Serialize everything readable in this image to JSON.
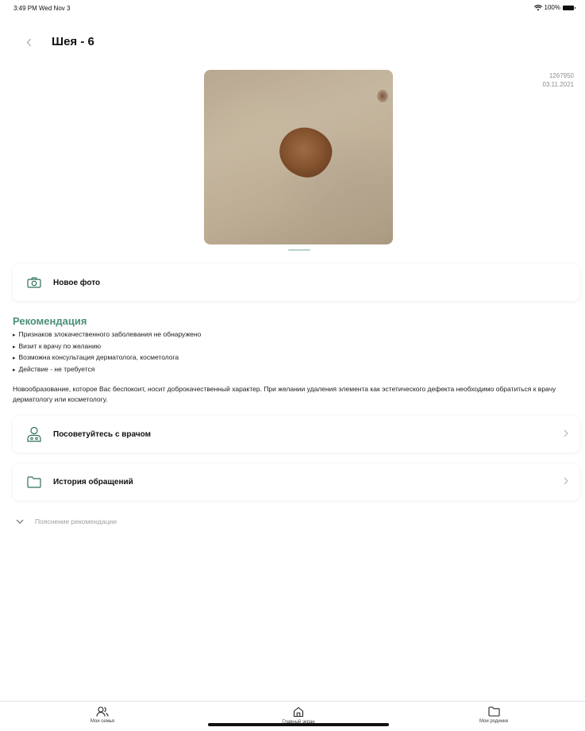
{
  "status_bar": {
    "time": "3:49 PM  Wed Nov 3",
    "battery": "100%"
  },
  "header": {
    "title": "Шея - 6"
  },
  "photo": {
    "id": "1267950",
    "date": "03.11.2021"
  },
  "new_photo": {
    "label": "Новое фото"
  },
  "recommendation": {
    "title": "Рекомендация",
    "items": [
      "Признаков злокачественного заболевания не обнаружено",
      "Визит к врачу по желанию",
      "Возможна консультация дерматолога, косметолога",
      "Действие - не требуется"
    ],
    "text": "Новообразование, которое Вас беспокоит, носит доброкачественный характер. При желании удаления элемента как эстетического дефекта необходимо обратиться к врачу дерматологу или косметологу."
  },
  "actions": {
    "consult": {
      "label": "Посоветуйтесь с врачом"
    },
    "history": {
      "label": "История обращений"
    }
  },
  "explanation": {
    "label": "Пояснение рекомендации"
  },
  "tabbar": {
    "family": "Мои семья",
    "home": "Главный экран",
    "moles": "Мои родинки"
  },
  "colors": {
    "accent": "#4a8f7b",
    "icon": "#2f6f5e"
  },
  "icons": {
    "back": "chevron-left-icon",
    "camera": "camera-icon",
    "doctor": "doctor-icon",
    "folder": "folder-icon",
    "expand": "chevron-down-icon",
    "family": "people-icon",
    "home": "home-icon"
  }
}
